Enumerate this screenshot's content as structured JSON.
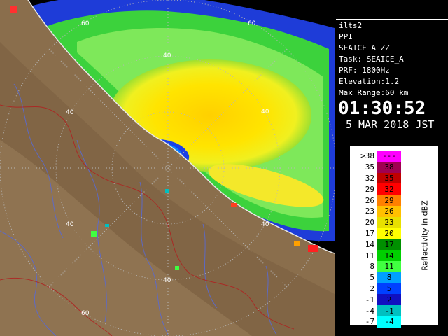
{
  "info": {
    "station": "ilts2",
    "mode": "PPI",
    "scan": "SEAICE_A_ZZ",
    "task": "Task: SEAICE_A",
    "prf": "PRF: 1800Hz",
    "elevation": "Elevation:1.2",
    "max_range": "Max Range:60 km",
    "time": "01:30:52",
    "date": "5 MAR 2018 JST"
  },
  "range_ring_labels": [
    "60",
    "40",
    "60",
    "40",
    "40",
    "40",
    "40",
    "40",
    "60"
  ],
  "legend": {
    "units": "Reflectivity in dBZ",
    "rows": [
      {
        "lo": ">38",
        "hi": "---",
        "color": "#ff00ff"
      },
      {
        "lo": "35",
        "hi": "38",
        "color": "#a00050"
      },
      {
        "lo": "32",
        "hi": "35",
        "color": "#c00000"
      },
      {
        "lo": "29",
        "hi": "32",
        "color": "#ff0000"
      },
      {
        "lo": "26",
        "hi": "29",
        "color": "#ff8000"
      },
      {
        "lo": "23",
        "hi": "26",
        "color": "#ffc000"
      },
      {
        "lo": "20",
        "hi": "23",
        "color": "#e8e000"
      },
      {
        "lo": "17",
        "hi": "20",
        "color": "#ffff00"
      },
      {
        "lo": "14",
        "hi": "17",
        "color": "#009000"
      },
      {
        "lo": "11",
        "hi": "14",
        "color": "#00d000"
      },
      {
        "lo": "8",
        "hi": "11",
        "color": "#40ff40"
      },
      {
        "lo": "5",
        "hi": "8",
        "color": "#00a0ff"
      },
      {
        "lo": "2",
        "hi": "5",
        "color": "#0040ff"
      },
      {
        "lo": "-1",
        "hi": "2",
        "color": "#1010c0"
      },
      {
        "lo": "-4",
        "hi": "-1",
        "color": "#00c0c0"
      },
      {
        "lo": "-7",
        "hi": "-4",
        "color": "#00ffff"
      }
    ]
  }
}
